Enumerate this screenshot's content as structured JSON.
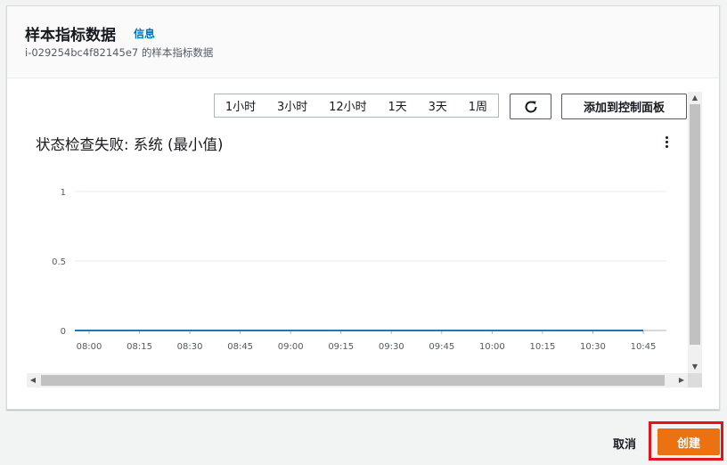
{
  "header": {
    "title": "样本指标数据",
    "info_link": "信息",
    "subtitle": "i-029254bc4f82145e7 的样本指标数据"
  },
  "toolbar": {
    "time_ranges": [
      "1小时",
      "3小时",
      "12小时",
      "1天",
      "3天",
      "1周"
    ],
    "refresh_icon": "refresh-icon",
    "add_to_dashboard_label": "添加到控制面板"
  },
  "chart": {
    "title": "状态检查失败: 系统 (最小值)",
    "menu_icon": "more-vertical-icon"
  },
  "chart_data": {
    "type": "line",
    "title": "状态检查失败: 系统 (最小值)",
    "x": [
      "08:00",
      "08:15",
      "08:30",
      "08:45",
      "09:00",
      "09:15",
      "09:30",
      "09:45",
      "10:00",
      "10:15",
      "10:30",
      "10:45"
    ],
    "series": [
      {
        "values": [
          0,
          0,
          0,
          0,
          0,
          0,
          0,
          0,
          0,
          0,
          0,
          0
        ]
      }
    ],
    "yticks": [
      "0",
      "0.5",
      "1"
    ],
    "ylim": [
      0,
      1
    ],
    "grid": true,
    "series_color": "#1f77b4"
  },
  "footer": {
    "cancel_label": "取消",
    "create_label": "创建"
  },
  "colors": {
    "primary_button": "#ec7211",
    "link": "#0073bb",
    "highlight_border": "#e0161c"
  }
}
